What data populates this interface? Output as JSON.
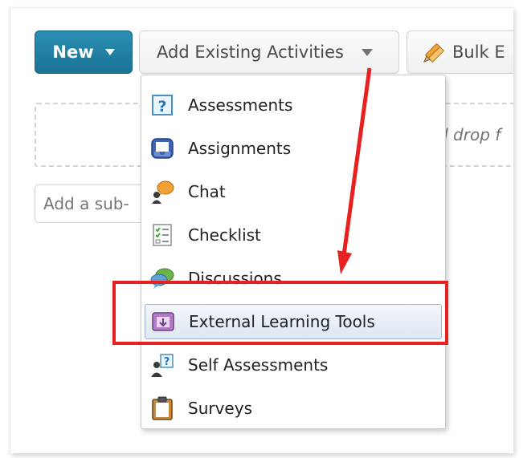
{
  "toolbar": {
    "new_label": "New",
    "add_existing_label": "Add Existing Activities",
    "bulk_label": "Bulk E"
  },
  "content": {
    "drop_hint": "d drop f",
    "subinput_placeholder": "Add a sub-"
  },
  "menu": {
    "items": [
      {
        "label": "Assessments",
        "icon": "question-icon"
      },
      {
        "label": "Assignments",
        "icon": "inbox-tray-icon"
      },
      {
        "label": "Chat",
        "icon": "chat-person-icon"
      },
      {
        "label": "Checklist",
        "icon": "checklist-icon"
      },
      {
        "label": "Discussions",
        "icon": "discussion-bubbles-icon"
      },
      {
        "label": "External Learning Tools",
        "icon": "external-tool-icon"
      },
      {
        "label": "Self Assessments",
        "icon": "self-assessment-icon"
      },
      {
        "label": "Surveys",
        "icon": "clipboard-icon"
      }
    ],
    "highlighted_index": 5
  },
  "annotation": {
    "color": "#e8201f"
  },
  "colors": {
    "primary": "#1b7396",
    "active_item_bg": "#dfe7f3"
  }
}
